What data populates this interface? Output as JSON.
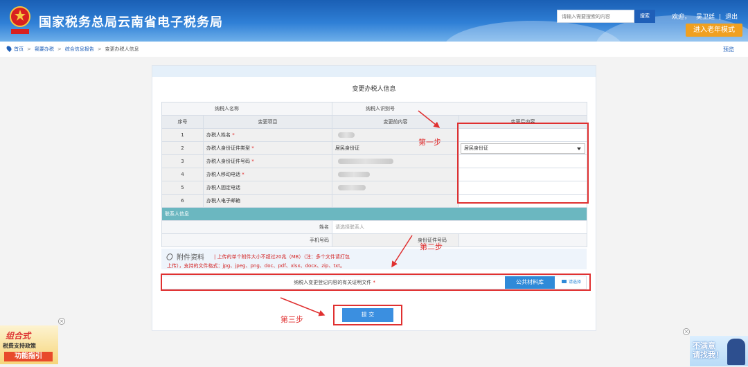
{
  "header": {
    "title": "国家税务总局云南省电子税务局",
    "search_placeholder": "请输入需要搜索的内容",
    "search_button": "搜索",
    "welcome": "欢迎，",
    "user_name": "吴卫廷",
    "separator": "|",
    "logout": "退出",
    "elder_mode": "进入老年模式"
  },
  "breadcrumb": {
    "items": [
      "首页",
      "我要办税",
      "综合信息报告",
      "变更办税人信息"
    ],
    "separator": ">",
    "preview": "预览"
  },
  "form": {
    "title": "变更办税人信息",
    "taxpayer_name_label": "纳税人名称",
    "taxpayer_id_label": "纳税人识别号",
    "columns": [
      "序号",
      "变更项目",
      "变更前内容",
      "变更后内容"
    ],
    "rows": [
      {
        "no": "1",
        "item": "办税人姓名",
        "required": true,
        "before": ""
      },
      {
        "no": "2",
        "item": "办税人身份证件类型",
        "required": true,
        "before": "居民身份证"
      },
      {
        "no": "3",
        "item": "办税人身份证件号码",
        "required": true,
        "before": ""
      },
      {
        "no": "4",
        "item": "办税人移动电话",
        "required": true,
        "before": ""
      },
      {
        "no": "5",
        "item": "办税人固定电话",
        "required": false,
        "before": ""
      },
      {
        "no": "6",
        "item": "办税人电子邮箱",
        "required": false,
        "before": ""
      }
    ],
    "required_mark": "*",
    "after_select_value": "居民身份证",
    "contact_section": "联系人信息",
    "contact_name_label": "姓名",
    "contact_name_placeholder": "请选择联系人",
    "mobile_label": "手机号码",
    "id_number_label": "身份证件号码"
  },
  "attachment": {
    "title": "附件资料",
    "note_line1": "| 上传的单个附件大小不超过20兆（MB）（注：多个文件请打包",
    "note_line2": "上传），支持的文件格式：jpg、jpeg、png、doc、pdf、xlsx、docx、zip、txt。",
    "file_label": "纳税人变更登记内容的有关证明文件",
    "required_mark": "*",
    "public_library": "公共材料库",
    "choose": "请选择"
  },
  "submit_label": "提 交",
  "annotations": {
    "step1": "第一步",
    "step2": "第二步",
    "step3": "第三步",
    "color": "#e03030"
  },
  "banners": {
    "left_line1": "组合式",
    "left_line2": "税费支持政策",
    "left_line3": "功能指引",
    "right_text": "不满意 请找我！",
    "close": "×"
  },
  "colors": {
    "header_blue": "#1a5fb4",
    "accent_orange": "#f0a020",
    "section_teal": "#6bb7c0",
    "button_blue": "#3b8fe0"
  }
}
